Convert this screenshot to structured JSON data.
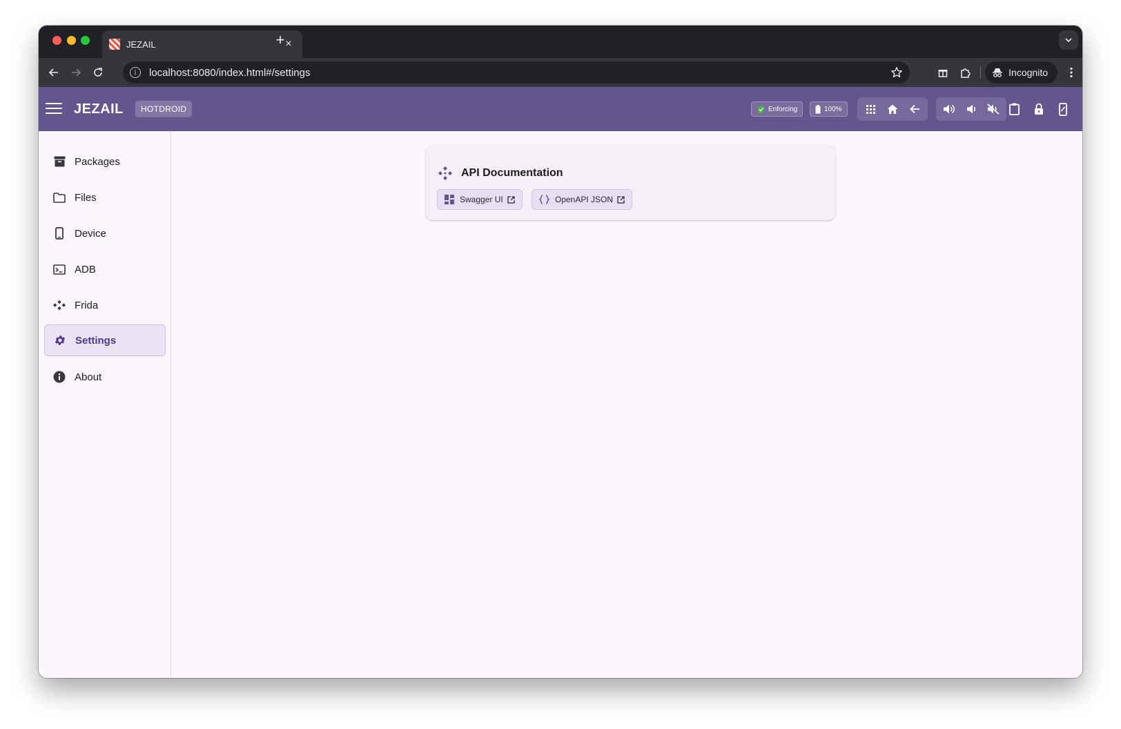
{
  "browser": {
    "tab_title": "JEZAIL",
    "tab_close": "×",
    "new_tab": "+",
    "url": "localhost:8080/index.html#/settings",
    "profile_label": "Incognito"
  },
  "appbar": {
    "title": "JEZAIL",
    "device": "HOTDROID",
    "selinux_status": "Enforcing",
    "battery": "100%"
  },
  "sidebar": {
    "items": [
      {
        "label": "Packages",
        "icon": "archive-icon"
      },
      {
        "label": "Files",
        "icon": "folder-icon"
      },
      {
        "label": "Device",
        "icon": "phone-icon"
      },
      {
        "label": "ADB",
        "icon": "terminal-icon"
      },
      {
        "label": "Frida",
        "icon": "frida-icon"
      },
      {
        "label": "Settings",
        "icon": "gear-icon",
        "active": true
      },
      {
        "label": "About",
        "icon": "info-icon"
      }
    ]
  },
  "api_docs": {
    "title": "API Documentation",
    "swagger_label": "Swagger UI",
    "openapi_label": "OpenAPI JSON"
  },
  "colors": {
    "appbar": "#65558f",
    "active_nav_bg": "#ebe2f4",
    "active_nav_text": "#4f378b",
    "card_bg": "#f5f0f7"
  }
}
